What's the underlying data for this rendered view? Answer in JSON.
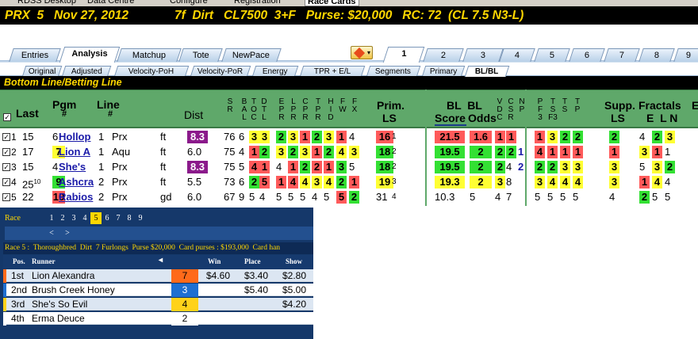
{
  "top_tabs": [
    "RDSS Desktop",
    "Data Centre",
    "Configure",
    "Registration",
    "Race Cards"
  ],
  "header": {
    "race": "PRX  5   Nov 27, 2012",
    "info": "7f  Dirt   CL7500  3+F   Purse: $20,000   RC: 72  (CL 7.5 N3-L)"
  },
  "main_tabs": [
    "Entries",
    "Analysis",
    "Matchup",
    "Tote",
    "NewPace"
  ],
  "race_numbers": [
    "1",
    "2",
    "3",
    "4",
    "5",
    "6",
    "7",
    "8",
    "9"
  ],
  "sub_tabs": [
    "Original",
    "Adjusted",
    "Velocity-PoH",
    "Velocity-PoR",
    "Energy",
    "TPR + E/L",
    "Segments",
    "Primary",
    "BL/BL"
  ],
  "section_title": "Bottom Line/Betting Line",
  "columns": {
    "last": "Last",
    "pgm": "Pgm",
    "pgm_hash": "#",
    "line": "Line",
    "line_hash": "#",
    "dist": "Dist",
    "prim": "Prim.",
    "ls": "LS",
    "bl": "BL  BL",
    "score": "Score",
    "odds": "Odds",
    "supp": "Supp.",
    "fractals": "Fractals",
    "eln": "E  L N",
    "fb": "F",
    "sub": [
      "S R",
      "B A L",
      "T O C",
      "D T L",
      "E P R",
      "L P R",
      "C P R",
      "T D",
      "H I",
      "F W",
      "F X"
    ],
    "vdc": "V D C",
    "csr": "C S R",
    "np": "N P",
    "pfs": "P F 3",
    "tfs": "T S F3",
    "ts": "T S",
    "psp": "S P",
    "e_tail": "E"
  },
  "rows": [
    {
      "num": "1",
      "last": "15",
      "pgm": "6",
      "name": "Hollop",
      "line": "1",
      "trk": "Prx",
      "surf": "ft",
      "dist": "8.3",
      "sr": "76",
      "b": "6",
      "t": "3",
      "d": "3",
      "e": "2",
      "l": "3",
      "c": "1",
      "t2": "2",
      "h": "3",
      "f": "1",
      "fx": "4",
      "prim": "16",
      "prims": "1",
      "score": "21.5",
      "odds": "1.6",
      "v": "1",
      "cs": "1",
      "np": "",
      "p": "1",
      "f3": "3",
      "t3": "2",
      "s": "2",
      "supp": "2",
      "e2": "4",
      "l2": "2",
      "n2": "3"
    },
    {
      "num": "2",
      "last": "17",
      "pgm": "7",
      "name": "Lion A",
      "line": "1",
      "trk": "Aqu",
      "surf": "ft",
      "dist": "6.0",
      "sr": "75",
      "b": "4",
      "t": "1",
      "d": "2",
      "e": "3",
      "l": "2",
      "c": "3",
      "t2": "1",
      "h": "2",
      "f": "4",
      "fx": "3",
      "prim": "18",
      "prims": "2",
      "score": "19.5",
      "odds": "2",
      "v": "2",
      "cs": "2",
      "np": "1",
      "p": "4",
      "f3": "1",
      "t3": "1",
      "s": "1",
      "supp": "1",
      "e2": "3",
      "l2": "1",
      "n2": "1"
    },
    {
      "num": "3",
      "last": "15",
      "pgm": "4",
      "name": "She's",
      "line": "1",
      "trk": "Prx",
      "surf": "ft",
      "dist": "8.3",
      "sr": "75",
      "b": "5",
      "t": "4",
      "d": "1",
      "e": "4",
      "l": "1",
      "c": "2",
      "t2": "2",
      "h": "1",
      "f": "3",
      "fx": "5",
      "prim": "18",
      "prims": "2",
      "score": "19.5",
      "odds": "2",
      "v": "2",
      "cs": "4",
      "np": "2",
      "p": "2",
      "f3": "2",
      "t3": "3",
      "s": "3",
      "supp": "3",
      "e2": "5",
      "l2": "3",
      "n2": "2"
    },
    {
      "num": "4",
      "last": "25",
      "lastsup": "10",
      "pgm": "9",
      "name": "Ashcra",
      "line": "2",
      "trk": "Prx",
      "surf": "ft",
      "dist": "5.5",
      "sr": "73",
      "b": "6",
      "t": "2",
      "d": "5",
      "e": "1",
      "l": "4",
      "c": "4",
      "t2": "3",
      "h": "4",
      "f": "2",
      "fx": "1",
      "prim": "19",
      "prims": "3",
      "score": "19.3",
      "odds": "2",
      "v": "3",
      "cs": "8",
      "np": "",
      "p": "3",
      "f3": "4",
      "t3": "4",
      "s": "4",
      "supp": "3",
      "e2": "1",
      "l2": "4",
      "n2": "4"
    },
    {
      "num": "5",
      "last": "22",
      "pgm": "10",
      "name": "Rabios",
      "line": "2",
      "trk": "Prx",
      "surf": "gd",
      "dist": "6.0",
      "sr": "67",
      "b": "9",
      "t": "5",
      "d": "4",
      "e": "5",
      "l": "5",
      "c": "5",
      "t2": "4",
      "h": "5",
      "f": "5",
      "fx": "2",
      "prim": "31",
      "prims": "4",
      "score": "10.3",
      "odds": "5",
      "v": "4",
      "cs": "7",
      "np": "",
      "p": "5",
      "f3": "5",
      "t3": "5",
      "s": "5",
      "supp": "4",
      "e2": "2",
      "l2": "5",
      "n2": "5"
    }
  ],
  "results": {
    "race_label": "Race",
    "races": [
      "1",
      "2",
      "3",
      "4",
      "5",
      "6",
      "7",
      "8",
      "9"
    ],
    "nav": [
      "<",
      ">"
    ],
    "info": "Race 5 :  Thoroughbred  Dirt  7 Furlongs  Purse $20,000  Card purses : $193,000  Card han",
    "headers": [
      "Pos.",
      "Runner",
      "",
      "Win",
      "Place",
      "Show"
    ],
    "rows": [
      {
        "pos": "1st",
        "runner": "Lion Alexandra",
        "pgm": "7",
        "win": "$4.60",
        "place": "$3.40",
        "show": "$2.80",
        "color": "#ff6a1a"
      },
      {
        "pos": "2nd",
        "runner": "Brush Creek Honey",
        "pgm": "3",
        "win": "",
        "place": "$5.40",
        "show": "$5.00",
        "color": "#1f6fd1"
      },
      {
        "pos": "3rd",
        "runner": "She's So Evil",
        "pgm": "4",
        "win": "",
        "place": "",
        "show": "$4.20",
        "color": "#ffd21a"
      },
      {
        "pos": "4th",
        "runner": "Erma Deuce",
        "pgm": "2",
        "win": "",
        "place": "",
        "show": "",
        "color": "#ffffff"
      }
    ]
  }
}
